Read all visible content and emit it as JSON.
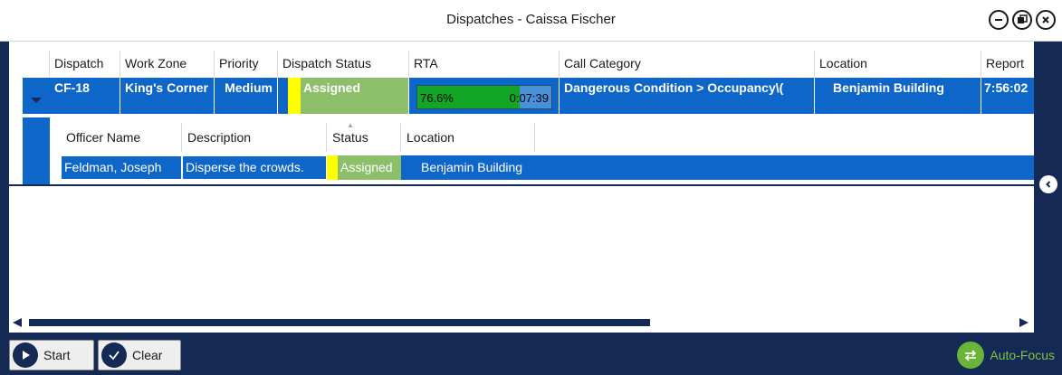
{
  "window": {
    "title": "Dispatches - Caissa Fischer"
  },
  "grid": {
    "columns": [
      "Dispatch",
      "Work Zone",
      "Priority",
      "Dispatch Status",
      "RTA",
      "Call Category",
      "Location",
      "Report"
    ],
    "row": {
      "dispatch": "CF-18",
      "work_zone": "King's Corner",
      "priority": "Medium",
      "dispatch_status": "Assigned",
      "rta_percent": "76.6%",
      "rta_progress": 0.766,
      "rta_time": "0:07:39",
      "call_category": "Dangerous Condition > Occupancy\\(",
      "location": "Benjamin Building",
      "reported": "7:56:02"
    }
  },
  "detail": {
    "columns": [
      "Officer Name",
      "Description",
      "Status",
      "Location"
    ],
    "row": {
      "officer_name": "Feldman, Joseph",
      "description": "Disperse the crowds.",
      "status": "Assigned",
      "location": "Benjamin Building"
    }
  },
  "toolbar": {
    "start_label": "Start",
    "clear_label": "Clear",
    "autofocus_label": "Auto-Focus"
  },
  "colors": {
    "selection_blue": "#0e66c8",
    "frame_navy": "#142a55",
    "status_yellow": "#ffff00",
    "status_green": "#8dbe6a",
    "rta_green": "#12a526",
    "autofocus_green": "#7ec242"
  },
  "icons": {
    "minimize": "minimize-icon",
    "restore": "restore-icon",
    "close": "close-icon",
    "expander": "chevron-down-icon",
    "collapse_side": "chevron-left-icon",
    "start": "play-icon",
    "clear": "checkmark-icon",
    "autofocus": "swap-arrows-icon"
  }
}
